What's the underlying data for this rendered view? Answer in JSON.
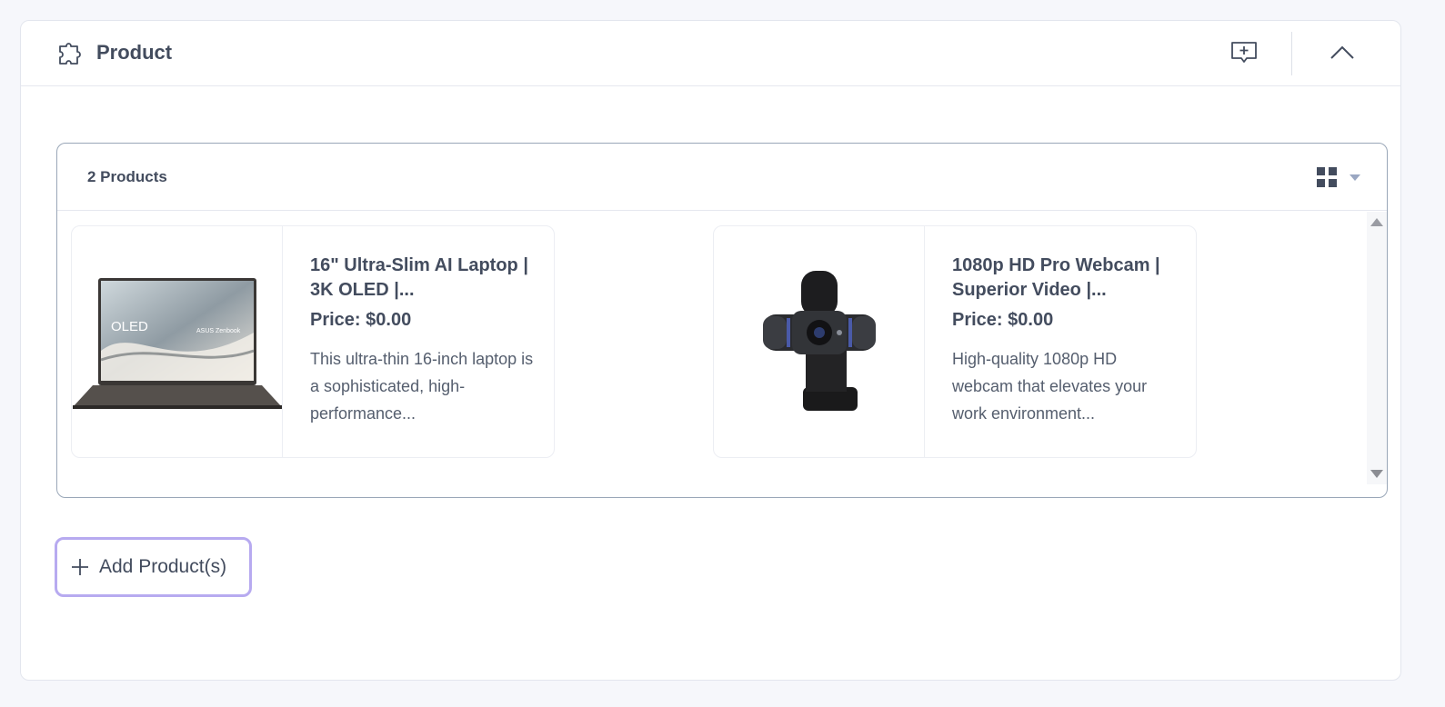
{
  "panel": {
    "title": "Product",
    "icon": "puzzle-icon",
    "actions": [
      {
        "name": "add-comment",
        "icon": "comment-plus-icon"
      },
      {
        "name": "collapse",
        "icon": "chevron-up-icon"
      }
    ]
  },
  "products": {
    "count_label": "2 Products",
    "view_toggle_icon": "grid-view-icon",
    "items": [
      {
        "title": "16\" Ultra-Slim AI Laptop | 3K OLED |...",
        "price": "Price: $0.00",
        "description": "This ultra-thin 16-inch laptop is a sophisticated, high-performance...",
        "image": "laptop-image",
        "image_screen_text": "OLED",
        "image_brand_text": "ASUS Zenbook"
      },
      {
        "title": "1080p HD Pro Webcam | Superior Video |...",
        "price": "Price: $0.00",
        "description": "High-quality 1080p HD webcam that elevates your work environment...",
        "image": "webcam-image"
      }
    ]
  },
  "add_button": {
    "label": "Add Product(s)",
    "icon": "plus-icon"
  },
  "colors": {
    "accent_border": "#b7aaf0",
    "text": "#434c5e",
    "box_border": "#9aa7b8"
  }
}
